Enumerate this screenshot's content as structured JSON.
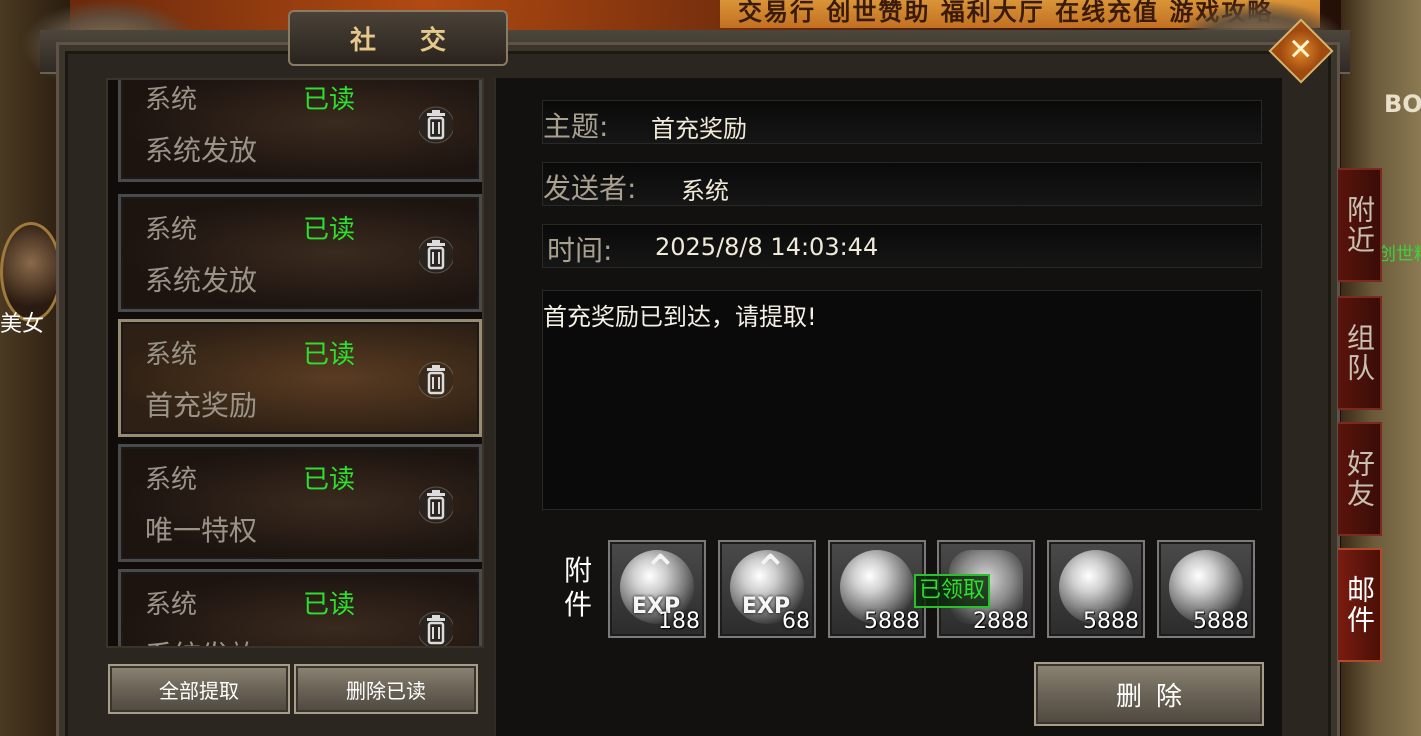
{
  "top_banner": "交易行  创世赞助  福利大厅  在线充值  游戏攻略",
  "side_left": {
    "portrait_name": "美女"
  },
  "side_right": {
    "bo_text": "BO",
    "green_text": "创世精"
  },
  "window": {
    "title": "社交"
  },
  "mail_list": [
    {
      "sender": "系统",
      "status": "已读",
      "title": "系统发放"
    },
    {
      "sender": "系统",
      "status": "已读",
      "title": "系统发放"
    },
    {
      "sender": "系统",
      "status": "已读",
      "title": "首充奖励",
      "selected": true
    },
    {
      "sender": "系统",
      "status": "已读",
      "title": "唯一特权"
    },
    {
      "sender": "系统",
      "status": "已读",
      "title": "系统发放"
    }
  ],
  "list_buttons": {
    "claim_all": "全部提取",
    "delete_read": "删除已读"
  },
  "detail": {
    "subject_label": "主题:",
    "subject": "首充奖励",
    "sender_label": "发送者:",
    "sender": "系统",
    "time_label": "时间:",
    "time": "2025/8/8 14:03:44",
    "body": "首充奖励已到达，请提取!",
    "attachments_label": "附件",
    "attachments": [
      {
        "icon": "exp-orb-icon",
        "qty": "188"
      },
      {
        "icon": "exp-orb-icon",
        "qty": "68"
      },
      {
        "icon": "gem-skull-icon",
        "qty": "5888"
      },
      {
        "icon": "scroll-icon",
        "qty": "2888"
      },
      {
        "icon": "sparkle-gem-icon",
        "qty": "5888"
      },
      {
        "icon": "sparkle-gem-icon",
        "qty": "5888"
      }
    ],
    "claimed_badge": "已领取",
    "delete_button": "删除"
  },
  "side_tabs": [
    {
      "label": "附近",
      "active": false
    },
    {
      "label": "组队",
      "active": false
    },
    {
      "label": "好友",
      "active": false
    },
    {
      "label": "邮件",
      "active": true
    }
  ],
  "colors": {
    "read_status": "#2ee02e",
    "accent_gold": "#e6c88a",
    "tab_red": "#5a140c"
  }
}
